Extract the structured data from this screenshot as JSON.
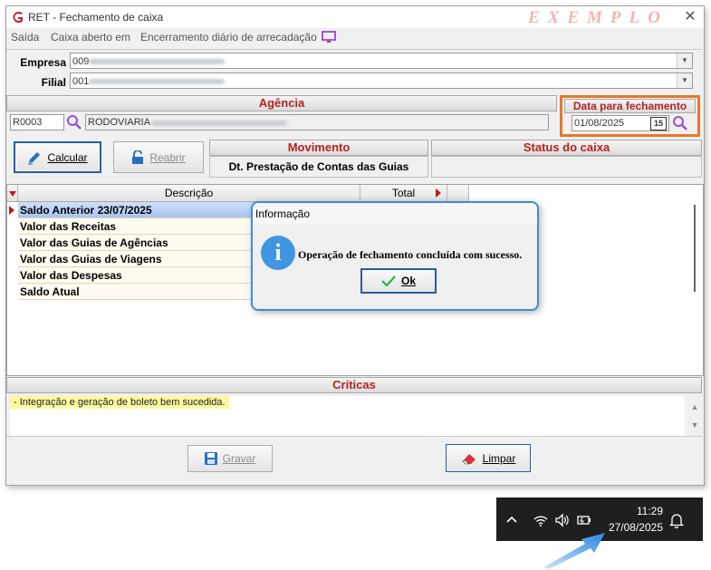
{
  "window": {
    "title": "RET - Fechamento de caixa",
    "watermark": "EXEMPLO",
    "close_glyph": "✕"
  },
  "menu": {
    "items": [
      "Saída",
      "Caixa aberto em",
      "Encerramento diário de arrecadação"
    ]
  },
  "company": {
    "empresa_label": "Empresa",
    "empresa_value": "009",
    "filial_label": "Filial",
    "filial_value": "001"
  },
  "agencia": {
    "header": "Agência",
    "code": "R0003",
    "name": "RODOVIARIA"
  },
  "data_fechamento": {
    "header": "Data para fechamento",
    "value": "01/08/2025",
    "calendar_label": "15"
  },
  "buttons": {
    "calcular": "Calcular",
    "reabrir": "Reabrir",
    "gravar": "Gravar",
    "limpar": "Limpar"
  },
  "movimento": {
    "header": "Movimento",
    "value": "Dt. Prestação de Contas das Guias"
  },
  "status_caixa": {
    "header": "Status do caixa"
  },
  "grid": {
    "columns": [
      "Descrição",
      "Total"
    ],
    "rows": [
      "Saldo Anterior  23/07/2025",
      "Valor das Receitas",
      "Valor das Guias de Agências",
      "Valor das Guias de Viagens",
      "Valor das Despesas",
      "Saldo Atual"
    ],
    "selected_row": 0
  },
  "criticas": {
    "header": "Críticas",
    "text": "- Integração e geração de boleto bem sucedida."
  },
  "dialog": {
    "title": "Informação",
    "message": "Operação de fechamento concluída com sucesso.",
    "ok_label": "Ok",
    "icon": "i"
  },
  "taskbar": {
    "time": "11:29",
    "date": "27/08/2025",
    "icons": [
      "chevron-up-icon",
      "wifi-icon",
      "speaker-icon",
      "battery-icon",
      "bell-icon"
    ]
  },
  "colors": {
    "accent_red": "#b32222",
    "highlight_orange": "#e8782a",
    "dialog_border": "#3c8ce0",
    "info_blue": "#3f95e2"
  }
}
